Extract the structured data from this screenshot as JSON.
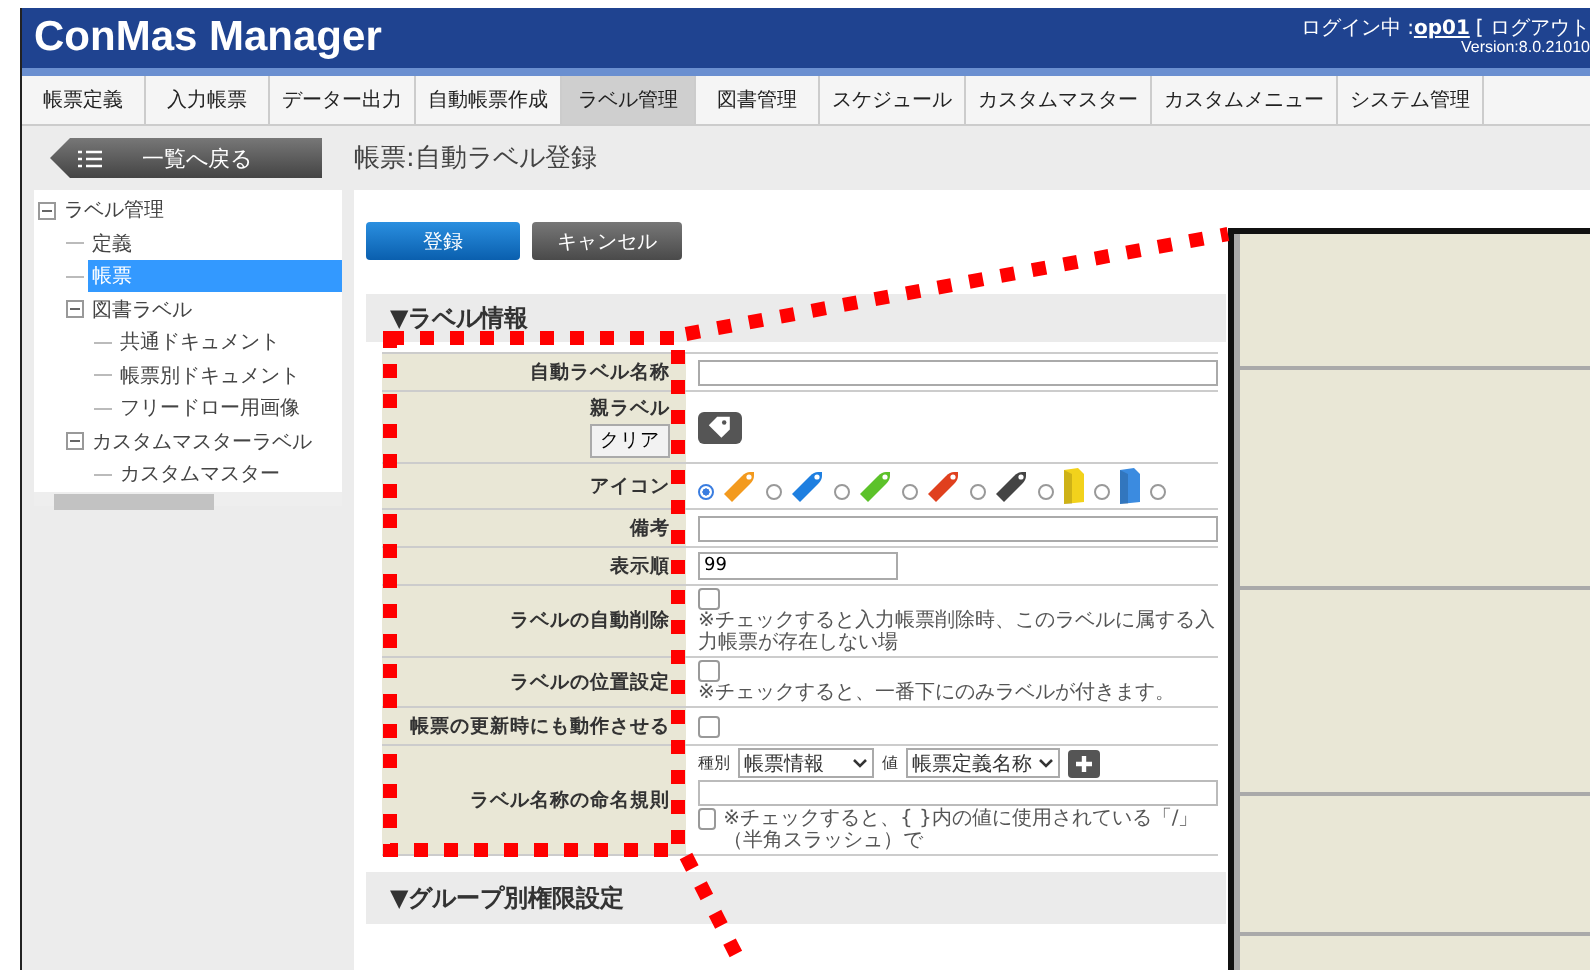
{
  "header": {
    "logo": "ConMas Manager",
    "login_label": "ログイン中 : ",
    "user": "op01",
    "logout": "[ ログアウト",
    "version": "Version:8.0.21010"
  },
  "tabs": [
    {
      "label": "帳票定義",
      "selected": false
    },
    {
      "label": "入力帳票",
      "selected": false
    },
    {
      "label": "データー出力",
      "selected": false
    },
    {
      "label": "自動帳票作成",
      "selected": false
    },
    {
      "label": "ラベル管理",
      "selected": true
    },
    {
      "label": "図書管理",
      "selected": false
    },
    {
      "label": "スケジュール",
      "selected": false
    },
    {
      "label": "カスタムマスター",
      "selected": false
    },
    {
      "label": "カスタムメニュー",
      "selected": false
    },
    {
      "label": "システム管理",
      "selected": false
    }
  ],
  "back_button": "一覧へ戻る",
  "page_title": "帳票:自動ラベル登録",
  "sidebar": {
    "tree": [
      {
        "label": "ラベル管理",
        "expanded": true,
        "selected": false,
        "children": [
          {
            "label": "定義",
            "selected": false
          },
          {
            "label": "帳票",
            "selected": true
          },
          {
            "label": "図書ラベル",
            "expanded": true,
            "selected": false,
            "children": [
              {
                "label": "共通ドキュメント",
                "selected": false
              },
              {
                "label": "帳票別ドキュメント",
                "selected": false
              },
              {
                "label": "フリードロー用画像",
                "selected": false
              }
            ]
          },
          {
            "label": "カスタムマスターラベル",
            "expanded": true,
            "selected": false,
            "children": [
              {
                "label": "カスタムマスター",
                "selected": false
              }
            ]
          }
        ]
      }
    ]
  },
  "actions": [
    {
      "label": "登録",
      "kind": "primary"
    },
    {
      "label": "キャンセル",
      "kind": "secondary"
    }
  ],
  "form": {
    "title": "▼ラベル情報",
    "rows": [
      {
        "kind": "text",
        "label": "自動ラベル名称"
      },
      {
        "kind": "parent",
        "label": "親ラベル",
        "button": "クリア"
      },
      {
        "kind": "icons",
        "label": "アイコン",
        "options": [
          {
            "kind": "tag",
            "color": "#f39a1e",
            "selected": true
          },
          {
            "kind": "tag",
            "color": "#1e7fe0",
            "selected": false
          },
          {
            "kind": "tag",
            "color": "#5cc22a",
            "selected": false
          },
          {
            "kind": "tag",
            "color": "#e0401e",
            "selected": false
          },
          {
            "kind": "tag",
            "color": "#444444",
            "selected": false
          },
          {
            "kind": "folder",
            "color": "#f2d21c",
            "selected": false
          },
          {
            "kind": "folder",
            "color": "#3b8be0",
            "selected": false
          },
          {
            "selected": false
          }
        ]
      },
      {
        "kind": "text",
        "label": "備考"
      },
      {
        "kind": "number",
        "label": "表示順",
        "value": "99"
      },
      {
        "kind": "check",
        "label": "ラベルの自動削除",
        "checked": false,
        "note": "※チェックすると入力帳票削除時、このラベルに属する入力帳票が存在しない場"
      },
      {
        "kind": "check",
        "label": "ラベルの位置設定",
        "checked": false,
        "note": "※チェックすると、一番下にのみラベルが付きます。"
      },
      {
        "kind": "check",
        "label": "帳票の更新時にも動作させる",
        "checked": false
      },
      {
        "kind": "naming",
        "label": "ラベル名称の命名規則",
        "type_label": "種別",
        "type_value": "帳票情報",
        "value_label": "値",
        "value_value": "帳票定義名称",
        "checked": false,
        "note": "※チェックすると、{ }内の値に使用されている「/」（半角スラッシュ）で"
      }
    ]
  },
  "group_section": {
    "title": "▼グループ別権限設定"
  }
}
